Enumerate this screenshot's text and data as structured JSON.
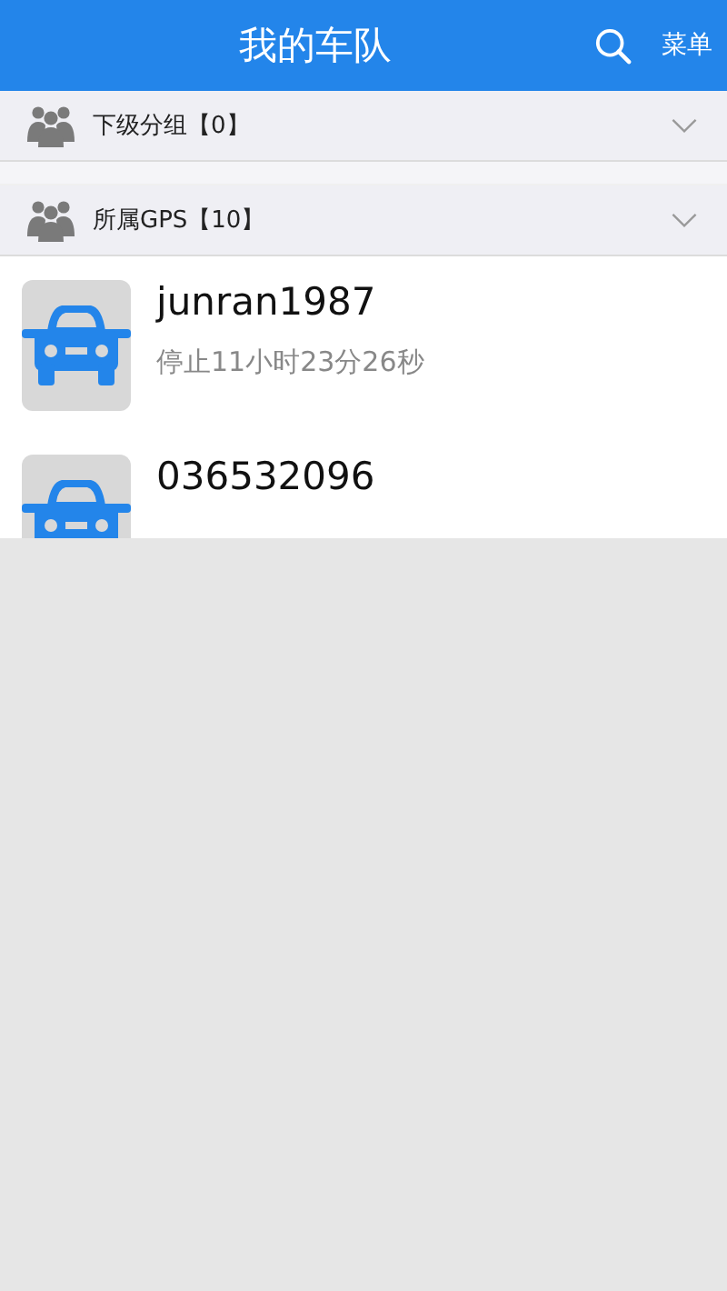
{
  "header": {
    "title": "我的车队",
    "menu": "菜单"
  },
  "groups": [
    {
      "label": "下级分组【0】",
      "expanded": false
    },
    {
      "label": "所属GPS【10】",
      "expanded": false
    }
  ],
  "vehicles": [
    {
      "name": "junran1987",
      "status": "停止11小时23分26秒"
    },
    {
      "name": "036532096"
    }
  ]
}
